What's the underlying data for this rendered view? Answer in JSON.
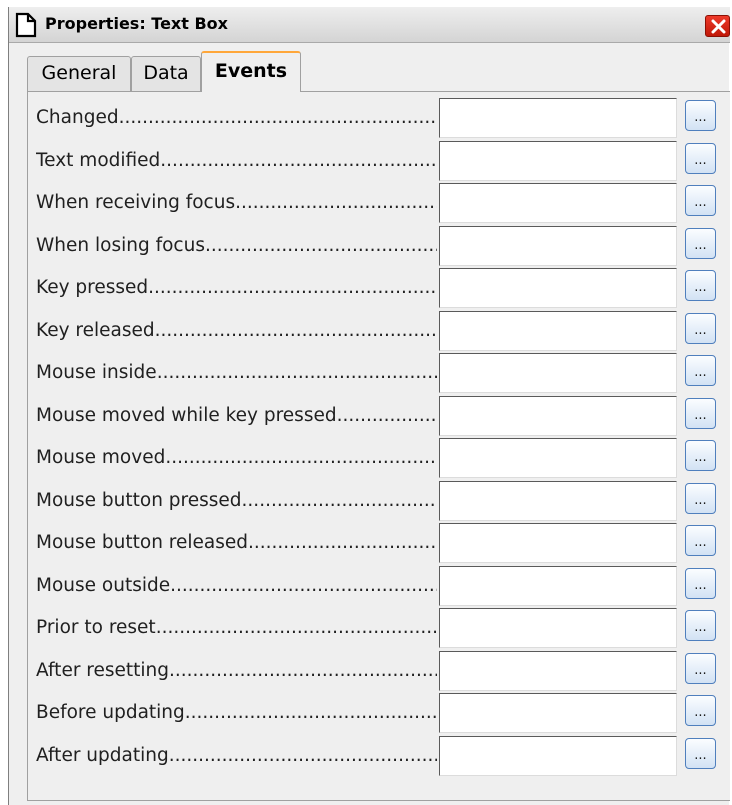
{
  "window": {
    "title": "Properties: Text Box",
    "icon": "document-icon",
    "close_icon": "close-icon"
  },
  "tabs": [
    {
      "label": "General",
      "active": false
    },
    {
      "label": "Data",
      "active": false
    },
    {
      "label": "Events",
      "active": true
    }
  ],
  "events": [
    {
      "label": "Changed",
      "value": "",
      "button_label": "..."
    },
    {
      "label": "Text modified",
      "value": "",
      "button_label": "..."
    },
    {
      "label": "When receiving focus",
      "value": "",
      "button_label": "..."
    },
    {
      "label": "When losing focus",
      "value": "",
      "button_label": "..."
    },
    {
      "label": "Key pressed",
      "value": "",
      "button_label": "..."
    },
    {
      "label": "Key released",
      "value": "",
      "button_label": "..."
    },
    {
      "label": "Mouse inside",
      "value": "",
      "button_label": "..."
    },
    {
      "label": "Mouse moved while key pressed",
      "value": "",
      "button_label": "..."
    },
    {
      "label": "Mouse moved",
      "value": "",
      "button_label": "..."
    },
    {
      "label": "Mouse button pressed",
      "value": "",
      "button_label": "..."
    },
    {
      "label": "Mouse button released",
      "value": "",
      "button_label": "..."
    },
    {
      "label": "Mouse outside",
      "value": "",
      "button_label": "..."
    },
    {
      "label": "Prior to reset",
      "value": "",
      "button_label": "..."
    },
    {
      "label": "After resetting",
      "value": "",
      "button_label": "..."
    },
    {
      "label": "Before updating",
      "value": "",
      "button_label": "..."
    },
    {
      "label": "After updating",
      "value": "",
      "button_label": "..."
    }
  ],
  "colors": {
    "active_tab_accent": "#ffa73a",
    "close_button": "#d62a18",
    "ellipsis_button_border": "#4f7fbd"
  }
}
